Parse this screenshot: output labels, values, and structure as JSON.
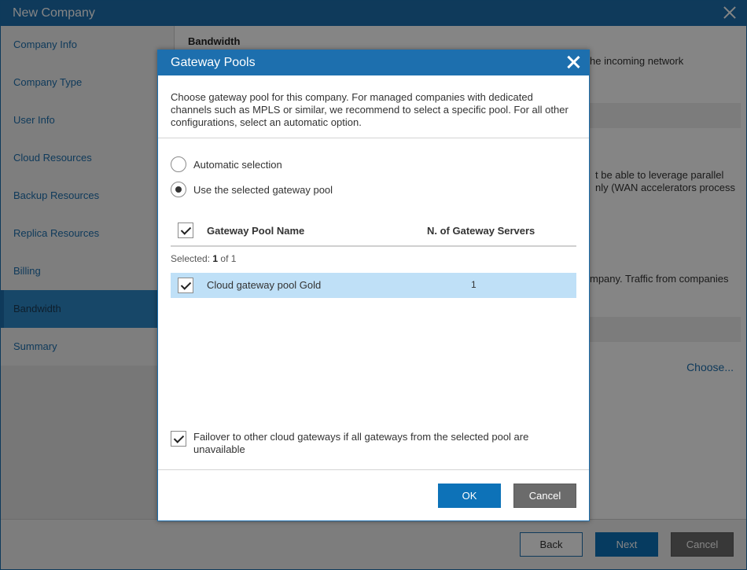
{
  "window": {
    "title": "New Company"
  },
  "sidebar": {
    "items": [
      {
        "label": "Company Info"
      },
      {
        "label": "Company Type"
      },
      {
        "label": "User Info"
      },
      {
        "label": "Cloud Resources"
      },
      {
        "label": "Backup Resources"
      },
      {
        "label": "Replica Resources"
      },
      {
        "label": "Billing"
      },
      {
        "label": "Bandwidth"
      },
      {
        "label": "Summary"
      }
    ],
    "active_index": 7
  },
  "main": {
    "heading": "Bandwidth",
    "fragment_1": "he incoming network",
    "fragment_2a": "t be able to leverage parallel",
    "fragment_2b": "nly (WAN accelerators process",
    "fragment_3": "mpany. Traffic from companies",
    "choose_link": "Choose..."
  },
  "footer": {
    "back_label": "Back",
    "next_label": "Next",
    "cancel_label": "Cancel"
  },
  "dialog": {
    "title": "Gateway Pools",
    "description": "Choose gateway pool for this company. For managed companies with dedicated channels such as MPLS or similar, we recommend to select a specific pool. For all other configurations, select an automatic option.",
    "radio_automatic": "Automatic selection",
    "radio_selected": "Use the selected gateway pool",
    "selected_option": "Use the selected gateway pool",
    "grid": {
      "col_name": "Gateway Pool Name",
      "col_count": "N. of Gateway Servers",
      "selected_prefix": "Selected:",
      "selected_count": "1",
      "selected_of": "of 1",
      "rows": [
        {
          "name": "Cloud gateway pool Gold",
          "servers": "1",
          "checked": true
        }
      ]
    },
    "failover_label": "Failover to other cloud gateways if all gateways from the selected pool are unavailable",
    "failover_checked": true,
    "ok_label": "OK",
    "cancel_label": "Cancel"
  },
  "colors": {
    "accent": "#1d6fae",
    "primary_button": "#0d72b8",
    "selected_row": "#bfe0f7",
    "secondary_button": "#6b6b6b"
  }
}
